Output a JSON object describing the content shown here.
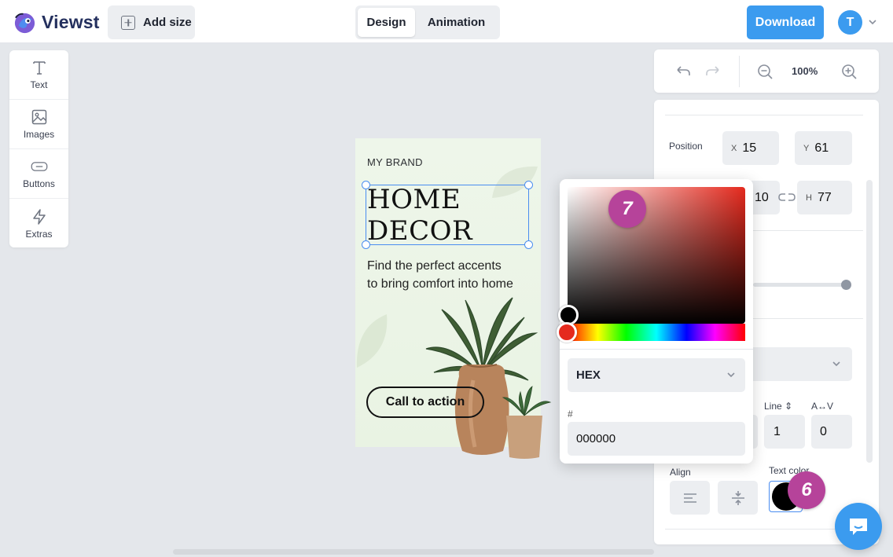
{
  "header": {
    "logo_text": "Viewst",
    "add_size_label": "Add size",
    "tabs": [
      {
        "label": "Design",
        "active": true
      },
      {
        "label": "Animation",
        "active": false
      }
    ],
    "download_label": "Download",
    "avatar_initial": "T"
  },
  "tools": [
    {
      "label": "Text",
      "icon": "text-icon"
    },
    {
      "label": "Images",
      "icon": "image-icon"
    },
    {
      "label": "Buttons",
      "icon": "button-icon"
    },
    {
      "label": "Extras",
      "icon": "lightning-icon"
    }
  ],
  "artboard": {
    "brand": "MY BRAND",
    "headline_line1": "HOME",
    "headline_line2": "DECOR",
    "subtitle_line1": "Find the perfect accents",
    "subtitle_line2": "to bring comfort into home",
    "cta_label": "Call to action"
  },
  "color_picker": {
    "format": "HEX",
    "hash_label": "#",
    "hex_value": "000000",
    "hue_color": "#e52a1e",
    "selected_color": "#000000"
  },
  "zoom": {
    "value": "100%"
  },
  "properties": {
    "position_label": "Position",
    "x_label": "X",
    "x_value": "15",
    "y_label": "Y",
    "y_value": "61",
    "w_value_partial": "10",
    "h_label": "H",
    "h_value": "77",
    "line_label": "Line ⇕",
    "line_value": "1",
    "spacing_label": "A↔V",
    "spacing_value": "0",
    "align_label": "Align",
    "text_color_label": "Text color",
    "text_color": "#000000"
  },
  "step_badges": {
    "seven": "7",
    "six": "6"
  },
  "colors": {
    "accent": "#3b9bef",
    "badge": "#b6439a",
    "selection": "#4a8df0"
  }
}
